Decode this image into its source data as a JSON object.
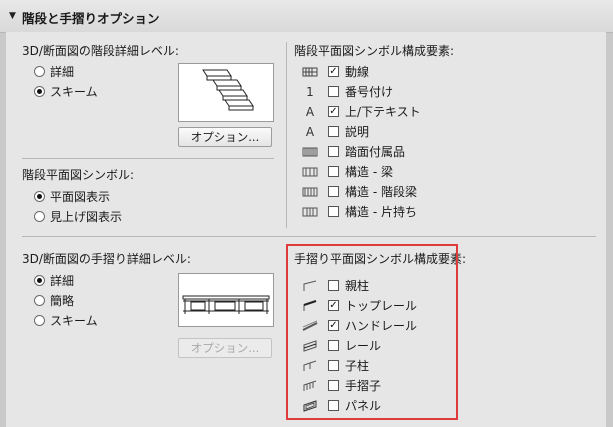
{
  "header": {
    "title": "階段と手摺りオプション"
  },
  "stair_detail": {
    "label": "3D/断面図の階段詳細レベル:",
    "options": [
      {
        "label": "詳細",
        "selected": false
      },
      {
        "label": "スキーム",
        "selected": true
      }
    ],
    "button": "オプション..."
  },
  "stair_symbol": {
    "label": "階段平面図シンボル:",
    "options": [
      {
        "label": "平面図表示",
        "selected": true
      },
      {
        "label": "見上げ図表示",
        "selected": false
      }
    ]
  },
  "stair_components": {
    "label": "階段平面図シンボル構成要素:",
    "items": [
      {
        "icon": "walking-line-icon",
        "label": "動線",
        "checked": true
      },
      {
        "icon": "number-icon",
        "label": "番号付け",
        "checked": false
      },
      {
        "icon": "text-a-icon",
        "label": "上/下テキスト",
        "checked": true
      },
      {
        "icon": "text-a-icon",
        "label": "説明",
        "checked": false
      },
      {
        "icon": "tread-accessory-icon",
        "label": "踏面付属品",
        "checked": false
      },
      {
        "icon": "beam-icon",
        "label": "構造 - 梁",
        "checked": false
      },
      {
        "icon": "stringer-icon",
        "label": "構造 - 階段梁",
        "checked": false
      },
      {
        "icon": "cantilever-icon",
        "label": "構造 - 片持ち",
        "checked": false
      }
    ]
  },
  "railing_detail": {
    "label": "3D/断面図の手摺り詳細レベル:",
    "options": [
      {
        "label": "詳細",
        "selected": true
      },
      {
        "label": "簡略",
        "selected": false
      },
      {
        "label": "スキーム",
        "selected": false
      }
    ],
    "button": "オプション..."
  },
  "railing_components": {
    "label": "手摺り平面図シンボル構成要素:",
    "items": [
      {
        "icon": "post-icon",
        "label": "親柱",
        "checked": false
      },
      {
        "icon": "top-rail-icon",
        "label": "トップレール",
        "checked": true
      },
      {
        "icon": "handrail-icon",
        "label": "ハンドレール",
        "checked": true
      },
      {
        "icon": "rail-icon",
        "label": "レール",
        "checked": false
      },
      {
        "icon": "inner-post-icon",
        "label": "子柱",
        "checked": false
      },
      {
        "icon": "baluster-icon",
        "label": "手摺子",
        "checked": false
      },
      {
        "icon": "panel-icon",
        "label": "パネル",
        "checked": false
      }
    ]
  },
  "symbols": {
    "number": "1",
    "text": "A",
    "check": "✓"
  }
}
